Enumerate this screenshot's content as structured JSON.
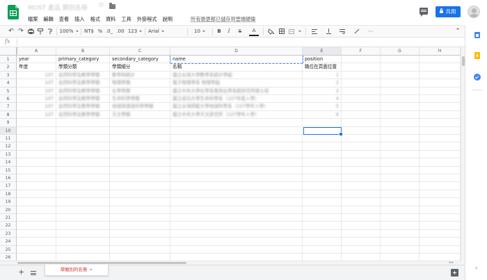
{
  "app": {
    "doc_title": "MOST 產品 類別名冊",
    "save_status": "所有變更都已儲存到雲端硬碟",
    "share_label": "共用"
  },
  "menus": [
    "檔案",
    "編輯",
    "查看",
    "插入",
    "格式",
    "資料",
    "工具",
    "外掛程式",
    "說明"
  ],
  "toolbar": {
    "zoom": "100%",
    "currency": "NT$",
    "percent": "%",
    "decimal_decrease": ".0_",
    "decimal_increase": ".00",
    "number_format": "123",
    "font": "Arial",
    "font_size": "10",
    "bold": "B",
    "italic": "I",
    "strikethrough": "S",
    "text_color": "A"
  },
  "formula_bar": {
    "fx": "fx",
    "value": ""
  },
  "columns": [
    "A",
    "B",
    "C",
    "D",
    "E",
    "F",
    "G",
    "H"
  ],
  "rows": [
    1,
    2,
    3,
    4,
    5,
    6,
    7,
    8,
    9,
    10,
    11,
    12,
    13,
    14,
    15,
    16,
    17,
    18,
    19,
    20,
    21,
    22,
    23,
    24,
    25,
    26
  ],
  "header_row_1": {
    "A": "year",
    "B": "primary_category",
    "C": "secondary_category",
    "D": "name",
    "E": "position"
  },
  "header_row_2": {
    "A": "年度",
    "B": "學類分類",
    "C": "學類細分",
    "D": "名稱",
    "E": "職位在頁面位置"
  },
  "blurred_rows": [
    {
      "A": "107",
      "B": "自然科學及數學學類",
      "C": "數學與統計",
      "D": "國立台灣大學數學系統計學組",
      "E": "1"
    },
    {
      "A": "107",
      "B": "自然科學及數學學類",
      "C": "物理學類",
      "D": "電子物理學系 物理學組",
      "E": "2"
    },
    {
      "A": "107",
      "B": "自然科學及數學學類",
      "C": "化學學類",
      "D": "國立中央大學化學系應用化學系統研究所碩士班",
      "E": "3"
    },
    {
      "A": "107",
      "B": "自然科學及數學學類",
      "C": "生命科學學類",
      "D": "國立成功大學生命科學系（107年度入學）",
      "E": "4"
    },
    {
      "A": "107",
      "B": "自然科學及數學學類",
      "C": "地球與環境科學學類",
      "D": "國立台灣師範大學地球科學系（107學年入學）",
      "E": "5"
    },
    {
      "A": "107",
      "B": "自然科學及數學學類",
      "C": "天文學類",
      "D": "國立中央大學天文研究所（107學年入學）",
      "E": "6"
    }
  ],
  "sheet_tab": {
    "label": "學類別的名冊"
  }
}
